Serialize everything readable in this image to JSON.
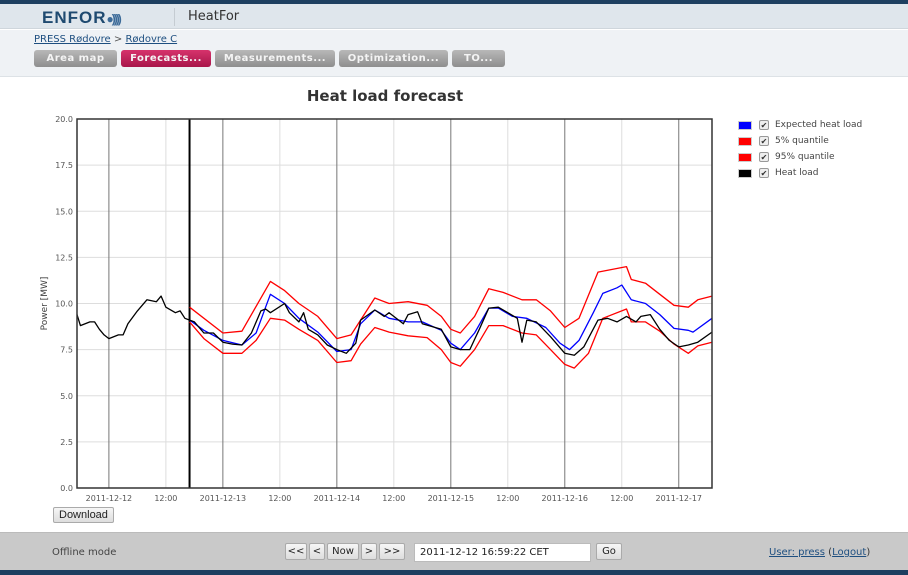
{
  "header": {
    "logo": "ENFOR",
    "app_name": "HeatFor"
  },
  "breadcrumb": {
    "items": [
      "PRESS Rødovre",
      "Rødovre C"
    ],
    "separator": ">"
  },
  "tabs": [
    {
      "label": "Area map",
      "active": false
    },
    {
      "label": "Forecasts...",
      "active": true
    },
    {
      "label": "Measurements...",
      "active": false
    },
    {
      "label": "Optimization...",
      "active": false
    },
    {
      "label": "TO...",
      "active": false
    }
  ],
  "colors": {
    "accent": "#b81d55",
    "expected": "#0000ff",
    "quantile": "#ff0000",
    "heat_load": "#000000",
    "header_bar": "#1d3f60"
  },
  "legend": [
    {
      "label": "Expected heat load",
      "color": "#0000ff",
      "checked": true
    },
    {
      "label": "5% quantile",
      "color": "#ff0000",
      "checked": true
    },
    {
      "label": "95% quantile",
      "color": "#ff0000",
      "checked": true
    },
    {
      "label": "Heat load",
      "color": "#000000",
      "checked": true
    }
  ],
  "download_label": "Download",
  "footer": {
    "mode": "Offline mode",
    "nav": [
      "<<",
      "<",
      "Now",
      ">",
      ">>"
    ],
    "datetime": "2011-12-12 16:59:22 CET",
    "go": "Go",
    "user_label": "User: press",
    "logout": "Logout"
  },
  "chart_data": {
    "type": "line",
    "title": "Heat load forecast",
    "ylabel": "Power [MW]",
    "xlabel": "",
    "ylim": [
      0,
      20
    ],
    "yticks": [
      "0.0",
      "2.5",
      "5.0",
      "7.5",
      "10.0",
      "12.5",
      "15.0",
      "17.5",
      "20.0"
    ],
    "xlim": [
      "2011-12-11T17:17",
      "2011-12-17T07:00"
    ],
    "xticks": [
      {
        "t": "2011-12-12T00:00",
        "label": "2011-12-12"
      },
      {
        "t": "2011-12-12T12:00",
        "label": "12:00"
      },
      {
        "t": "2011-12-13T00:00",
        "label": "2011-12-13"
      },
      {
        "t": "2011-12-13T12:00",
        "label": "12:00"
      },
      {
        "t": "2011-12-14T00:00",
        "label": "2011-12-14"
      },
      {
        "t": "2011-12-14T12:00",
        "label": "12:00"
      },
      {
        "t": "2011-12-15T00:00",
        "label": "2011-12-15"
      },
      {
        "t": "2011-12-15T12:00",
        "label": "12:00"
      },
      {
        "t": "2011-12-16T00:00",
        "label": "2011-12-16"
      },
      {
        "t": "2011-12-16T12:00",
        "label": "12:00"
      },
      {
        "t": "2011-12-17T00:00",
        "label": "2011-12-17"
      }
    ],
    "now_marker": "2011-12-12T16:59",
    "grid": true,
    "legend_position": "right",
    "series": [
      {
        "name": "95% quantile",
        "color": "#ff0000",
        "points": [
          [
            "2011-12-12T17:00",
            9.8
          ],
          [
            "2011-12-13T00:00",
            8.4
          ],
          [
            "2011-12-13T04:00",
            8.5
          ],
          [
            "2011-12-13T10:00",
            11.2
          ],
          [
            "2011-12-13T13:00",
            10.7
          ],
          [
            "2011-12-13T16:00",
            10.0
          ],
          [
            "2011-12-13T20:00",
            9.3
          ],
          [
            "2011-12-14T00:00",
            8.1
          ],
          [
            "2011-12-14T03:00",
            8.3
          ],
          [
            "2011-12-14T08:00",
            10.3
          ],
          [
            "2011-12-14T11:00",
            10.0
          ],
          [
            "2011-12-14T15:00",
            10.1
          ],
          [
            "2011-12-14T19:00",
            9.9
          ],
          [
            "2011-12-14T22:00",
            9.3
          ],
          [
            "2011-12-15T00:00",
            8.6
          ],
          [
            "2011-12-15T02:00",
            8.4
          ],
          [
            "2011-12-15T05:00",
            9.3
          ],
          [
            "2011-12-15T08:00",
            10.8
          ],
          [
            "2011-12-15T11:00",
            10.6
          ],
          [
            "2011-12-15T15:00",
            10.2
          ],
          [
            "2011-12-15T18:00",
            10.2
          ],
          [
            "2011-12-15T21:00",
            9.6
          ],
          [
            "2011-12-16T00:00",
            8.7
          ],
          [
            "2011-12-16T03:00",
            9.2
          ],
          [
            "2011-12-16T07:00",
            11.7
          ],
          [
            "2011-12-16T13:00",
            12.0
          ],
          [
            "2011-12-16T14:00",
            11.3
          ],
          [
            "2011-12-16T17:00",
            11.1
          ],
          [
            "2011-12-16T20:00",
            10.5
          ],
          [
            "2011-12-16T23:00",
            9.9
          ],
          [
            "2011-12-17T02:00",
            9.8
          ],
          [
            "2011-12-17T04:00",
            10.2
          ],
          [
            "2011-12-17T07:00",
            10.4
          ]
        ]
      },
      {
        "name": "5% quantile",
        "color": "#ff0000",
        "points": [
          [
            "2011-12-12T17:00",
            9.0
          ],
          [
            "2011-12-12T20:00",
            8.1
          ],
          [
            "2011-12-13T00:00",
            7.3
          ],
          [
            "2011-12-13T04:00",
            7.3
          ],
          [
            "2011-12-13T07:00",
            8.0
          ],
          [
            "2011-12-13T10:00",
            9.2
          ],
          [
            "2011-12-13T13:00",
            9.1
          ],
          [
            "2011-12-13T16:00",
            8.6
          ],
          [
            "2011-12-13T20:00",
            8.0
          ],
          [
            "2011-12-14T00:00",
            6.8
          ],
          [
            "2011-12-14T03:00",
            6.9
          ],
          [
            "2011-12-14T05:00",
            7.8
          ],
          [
            "2011-12-14T08:00",
            8.7
          ],
          [
            "2011-12-14T11:00",
            8.45
          ],
          [
            "2011-12-14T15:00",
            8.25
          ],
          [
            "2011-12-14T19:00",
            8.15
          ],
          [
            "2011-12-14T22:00",
            7.5
          ],
          [
            "2011-12-15T00:00",
            6.8
          ],
          [
            "2011-12-15T02:00",
            6.6
          ],
          [
            "2011-12-15T05:00",
            7.5
          ],
          [
            "2011-12-15T08:00",
            8.8
          ],
          [
            "2011-12-15T11:00",
            8.8
          ],
          [
            "2011-12-15T15:00",
            8.4
          ],
          [
            "2011-12-15T18:00",
            8.3
          ],
          [
            "2011-12-15T21:00",
            7.5
          ],
          [
            "2011-12-16T00:00",
            6.7
          ],
          [
            "2011-12-16T02:00",
            6.5
          ],
          [
            "2011-12-16T05:00",
            7.3
          ],
          [
            "2011-12-16T08:00",
            9.2
          ],
          [
            "2011-12-16T13:00",
            9.7
          ],
          [
            "2011-12-16T14:00",
            9.0
          ],
          [
            "2011-12-16T17:00",
            9.0
          ],
          [
            "2011-12-16T20:00",
            8.5
          ],
          [
            "2011-12-16T23:00",
            7.8
          ],
          [
            "2011-12-17T02:00",
            7.3
          ],
          [
            "2011-12-17T04:00",
            7.7
          ],
          [
            "2011-12-17T07:00",
            7.9
          ]
        ]
      },
      {
        "name": "Expected heat load",
        "color": "#0000ff",
        "points": [
          [
            "2011-12-12T17:00",
            9.1
          ],
          [
            "2011-12-12T20:00",
            8.55
          ],
          [
            "2011-12-13T00:00",
            8.0
          ],
          [
            "2011-12-13T04:00",
            7.75
          ],
          [
            "2011-12-13T07:00",
            8.4
          ],
          [
            "2011-12-13T09:00",
            9.8
          ],
          [
            "2011-12-13T10:00",
            10.5
          ],
          [
            "2011-12-13T13:00",
            10.0
          ],
          [
            "2011-12-13T16:00",
            9.2
          ],
          [
            "2011-12-13T20:00",
            8.45
          ],
          [
            "2011-12-14T00:00",
            7.4
          ],
          [
            "2011-12-14T03:00",
            7.5
          ],
          [
            "2011-12-14T05:00",
            8.9
          ],
          [
            "2011-12-14T08:00",
            9.65
          ],
          [
            "2011-12-14T11:00",
            9.2
          ],
          [
            "2011-12-14T15:00",
            9.0
          ],
          [
            "2011-12-14T18:00",
            9.0
          ],
          [
            "2011-12-14T22:00",
            8.55
          ],
          [
            "2011-12-15T00:00",
            7.85
          ],
          [
            "2011-12-15T02:00",
            7.5
          ],
          [
            "2011-12-15T05:00",
            8.4
          ],
          [
            "2011-12-15T08:00",
            9.75
          ],
          [
            "2011-12-15T10:00",
            9.75
          ],
          [
            "2011-12-15T13:00",
            9.3
          ],
          [
            "2011-12-15T16:00",
            9.2
          ],
          [
            "2011-12-15T20:00",
            8.7
          ],
          [
            "2011-12-15T23:00",
            7.85
          ],
          [
            "2011-12-16T01:00",
            7.5
          ],
          [
            "2011-12-16T03:00",
            8.0
          ],
          [
            "2011-12-16T06:00",
            9.5
          ],
          [
            "2011-12-16T08:00",
            10.55
          ],
          [
            "2011-12-16T11:00",
            10.85
          ],
          [
            "2011-12-16T12:00",
            11.0
          ],
          [
            "2011-12-16T14:00",
            10.2
          ],
          [
            "2011-12-16T17:00",
            10.0
          ],
          [
            "2011-12-16T20:00",
            9.4
          ],
          [
            "2011-12-16T23:00",
            8.65
          ],
          [
            "2011-12-17T02:00",
            8.55
          ],
          [
            "2011-12-17T03:00",
            8.45
          ],
          [
            "2011-12-17T07:00",
            9.2
          ]
        ]
      },
      {
        "name": "Heat load",
        "color": "#000000",
        "points": [
          [
            "2011-12-11T17:17",
            9.4
          ],
          [
            "2011-12-11T18:00",
            8.8
          ],
          [
            "2011-12-11T20:00",
            9.0
          ],
          [
            "2011-12-11T21:00",
            9.0
          ],
          [
            "2011-12-11T22:00",
            8.6
          ],
          [
            "2011-12-11T23:00",
            8.3
          ],
          [
            "2011-12-12T00:00",
            8.1
          ],
          [
            "2011-12-12T02:00",
            8.3
          ],
          [
            "2011-12-12T03:00",
            8.3
          ],
          [
            "2011-12-12T04:00",
            8.9
          ],
          [
            "2011-12-12T06:00",
            9.6
          ],
          [
            "2011-12-12T08:00",
            10.2
          ],
          [
            "2011-12-12T10:00",
            10.1
          ],
          [
            "2011-12-12T11:00",
            10.4
          ],
          [
            "2011-12-12T12:00",
            9.8
          ],
          [
            "2011-12-12T14:00",
            9.5
          ],
          [
            "2011-12-12T15:00",
            9.6
          ],
          [
            "2011-12-12T16:00",
            9.2
          ],
          [
            "2011-12-12T17:00",
            9.1
          ],
          [
            "2011-12-12T18:00",
            9.0
          ],
          [
            "2011-12-12T20:00",
            8.4
          ],
          [
            "2011-12-12T22:00",
            8.4
          ],
          [
            "2011-12-13T00:00",
            7.9
          ],
          [
            "2011-12-13T02:00",
            7.8
          ],
          [
            "2011-12-13T04:00",
            7.75
          ],
          [
            "2011-12-13T06:00",
            8.4
          ],
          [
            "2011-12-13T08:00",
            9.6
          ],
          [
            "2011-12-13T09:00",
            9.7
          ],
          [
            "2011-12-13T10:00",
            9.5
          ],
          [
            "2011-12-13T13:00",
            10.0
          ],
          [
            "2011-12-13T14:00",
            9.5
          ],
          [
            "2011-12-13T16:00",
            9.0
          ],
          [
            "2011-12-13T17:00",
            9.5
          ],
          [
            "2011-12-13T18:00",
            8.6
          ],
          [
            "2011-12-13T20:00",
            8.3
          ],
          [
            "2011-12-13T22:00",
            7.75
          ],
          [
            "2011-12-14T00:00",
            7.5
          ],
          [
            "2011-12-14T02:00",
            7.3
          ],
          [
            "2011-12-14T04:00",
            7.85
          ],
          [
            "2011-12-14T05:00",
            9.1
          ],
          [
            "2011-12-14T08:00",
            9.65
          ],
          [
            "2011-12-14T10:00",
            9.3
          ],
          [
            "2011-12-14T11:00",
            9.5
          ],
          [
            "2011-12-14T14:00",
            8.9
          ],
          [
            "2011-12-14T15:00",
            9.4
          ],
          [
            "2011-12-14T17:00",
            9.55
          ],
          [
            "2011-12-14T18:00",
            8.9
          ],
          [
            "2011-12-14T22:00",
            8.6
          ],
          [
            "2011-12-15T00:00",
            7.65
          ],
          [
            "2011-12-15T02:00",
            7.5
          ],
          [
            "2011-12-15T04:00",
            7.5
          ],
          [
            "2011-12-15T06:00",
            8.6
          ],
          [
            "2011-12-15T08:00",
            9.75
          ],
          [
            "2011-12-15T10:00",
            9.8
          ],
          [
            "2011-12-15T12:00",
            9.5
          ],
          [
            "2011-12-15T14:00",
            9.2
          ],
          [
            "2011-12-15T15:00",
            7.9
          ],
          [
            "2011-12-15T16:00",
            9.1
          ],
          [
            "2011-12-15T18:00",
            9.0
          ],
          [
            "2011-12-15T21:00",
            8.2
          ],
          [
            "2011-12-16T00:00",
            7.3
          ],
          [
            "2011-12-16T02:00",
            7.2
          ],
          [
            "2011-12-16T04:00",
            7.65
          ],
          [
            "2011-12-16T07:00",
            9.1
          ],
          [
            "2011-12-16T09:00",
            9.2
          ],
          [
            "2011-12-16T11:00",
            9.0
          ],
          [
            "2011-12-16T13:00",
            9.3
          ],
          [
            "2011-12-16T15:00",
            9.0
          ],
          [
            "2011-12-16T16:00",
            9.3
          ],
          [
            "2011-12-16T18:00",
            9.4
          ],
          [
            "2011-12-16T20:00",
            8.6
          ],
          [
            "2011-12-16T22:00",
            8.0
          ],
          [
            "2011-12-17T00:00",
            7.65
          ],
          [
            "2011-12-17T02:00",
            7.75
          ],
          [
            "2011-12-17T04:00",
            7.9
          ],
          [
            "2011-12-17T07:00",
            8.45
          ]
        ]
      }
    ]
  }
}
